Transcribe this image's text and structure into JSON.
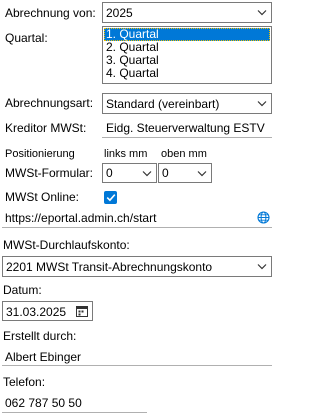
{
  "abrechnung_von": {
    "label": "Abrechnung von:",
    "value": "2025"
  },
  "quartal": {
    "label": "Quartal:",
    "options": [
      "1. Quartal",
      "2. Quartal",
      "3. Quartal",
      "4. Quartal"
    ],
    "selected_index": 0
  },
  "abrechnungsart": {
    "label": "Abrechnungsart:",
    "value": "Standard (vereinbart)"
  },
  "kreditor": {
    "label": "Kreditor MWSt:",
    "value": "Eidg. Steuerverwaltung ESTV"
  },
  "positionierung": {
    "label": "Positionierung",
    "col_links": "links mm",
    "col_oben": "oben mm"
  },
  "mwst_formular": {
    "label": "MWSt-Formular:",
    "links": "0",
    "oben": "0"
  },
  "mwst_online": {
    "label": "MWSt Online:",
    "checked": true
  },
  "url": {
    "value": "https://eportal.admin.ch/start",
    "icon": "globe-icon"
  },
  "durchlaufskonto": {
    "label": "MWSt-Durchlaufskonto:",
    "value": "2201 MWSt Transit-Abrechnungskonto"
  },
  "datum": {
    "label": "Datum:",
    "value": "31.03.2025",
    "icon": "calendar-icon"
  },
  "erstellt": {
    "label": "Erstellt durch:",
    "value": "Albert Ebinger"
  },
  "telefon": {
    "label": "Telefon:",
    "value": "062 787 50 50"
  },
  "colors": {
    "accent": "#0078d7",
    "border": "#7a7a7a"
  }
}
